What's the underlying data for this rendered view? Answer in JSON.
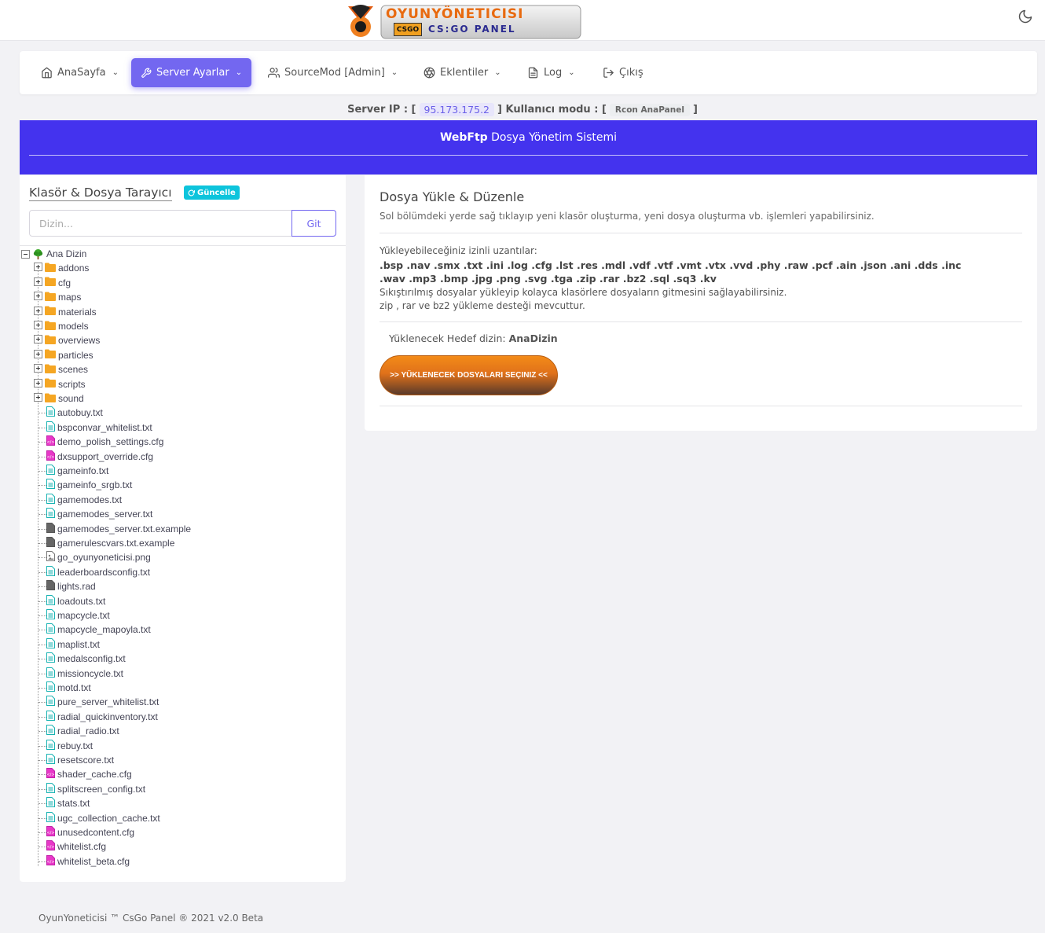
{
  "colors": {
    "accent": "#7367f0",
    "banner": "#4433ee",
    "refresh": "#0dc4dc",
    "upload_orange": "#f38b18"
  },
  "header": {
    "logo_text_top": "OYUNYÖNETICISI",
    "logo_text_badge": "CSGO",
    "logo_text_bottom": "CS:GO PANEL",
    "theme_icon": "moon-icon"
  },
  "nav": {
    "items": [
      {
        "label": "AnaSayfa",
        "icon": "home-icon"
      },
      {
        "label": "Server Ayarlar",
        "icon": "wrench-icon"
      },
      {
        "label": "SourceMod [Admin]",
        "icon": "users-icon"
      },
      {
        "label": "Eklentiler",
        "icon": "aperture-icon"
      },
      {
        "label": "Log",
        "icon": "file-text-icon"
      },
      {
        "label": "Çıkış",
        "icon": "logout-icon"
      }
    ]
  },
  "server": {
    "ip_label": "Server IP : [",
    "ip": "95.173.175.2",
    "mode_label": "] Kullanıcı modu : [",
    "mode": "Rcon AnaPanel",
    "close": "]"
  },
  "banner": {
    "title_bold": "WebFtp",
    "title_rest": " Dosya Yönetim Sistemi"
  },
  "browser": {
    "title": "Klasör & Dosya Tarayıcı",
    "refresh_label": "Güncelle",
    "dir_placeholder": "Dizin...",
    "go_label": "Git",
    "root": "Ana Dizin",
    "folders": [
      "addons",
      "cfg",
      "maps",
      "materials",
      "models",
      "overviews",
      "particles",
      "scenes",
      "scripts",
      "sound"
    ],
    "files": [
      {
        "name": "autobuy.txt",
        "type": "txt"
      },
      {
        "name": "bspconvar_whitelist.txt",
        "type": "txt"
      },
      {
        "name": "demo_polish_settings.cfg",
        "type": "cfg"
      },
      {
        "name": "dxsupport_override.cfg",
        "type": "cfg"
      },
      {
        "name": "gameinfo.txt",
        "type": "txt"
      },
      {
        "name": "gameinfo_srgb.txt",
        "type": "txt"
      },
      {
        "name": "gamemodes.txt",
        "type": "txt"
      },
      {
        "name": "gamemodes_server.txt",
        "type": "txt"
      },
      {
        "name": "gamemodes_server.txt.example",
        "type": "gen"
      },
      {
        "name": "gamerulescvars.txt.example",
        "type": "gen"
      },
      {
        "name": "go_oyunyoneticisi.png",
        "type": "img"
      },
      {
        "name": "leaderboardsconfig.txt",
        "type": "txt"
      },
      {
        "name": "lights.rad",
        "type": "gen"
      },
      {
        "name": "loadouts.txt",
        "type": "txt"
      },
      {
        "name": "mapcycle.txt",
        "type": "txt"
      },
      {
        "name": "mapcycle_mapoyla.txt",
        "type": "txt"
      },
      {
        "name": "maplist.txt",
        "type": "txt"
      },
      {
        "name": "medalsconfig.txt",
        "type": "txt"
      },
      {
        "name": "missioncycle.txt",
        "type": "txt"
      },
      {
        "name": "motd.txt",
        "type": "txt"
      },
      {
        "name": "pure_server_whitelist.txt",
        "type": "txt"
      },
      {
        "name": "radial_quickinventory.txt",
        "type": "txt"
      },
      {
        "name": "radial_radio.txt",
        "type": "txt"
      },
      {
        "name": "rebuy.txt",
        "type": "txt"
      },
      {
        "name": "resetscore.txt",
        "type": "txt"
      },
      {
        "name": "shader_cache.cfg",
        "type": "cfg"
      },
      {
        "name": "splitscreen_config.txt",
        "type": "txt"
      },
      {
        "name": "stats.txt",
        "type": "txt"
      },
      {
        "name": "ugc_collection_cache.txt",
        "type": "txt"
      },
      {
        "name": "unusedcontent.cfg",
        "type": "cfg"
      },
      {
        "name": "whitelist.cfg",
        "type": "cfg"
      },
      {
        "name": "whitelist_beta.cfg",
        "type": "cfg"
      }
    ]
  },
  "upload": {
    "title": "Dosya Yükle & Düzenle",
    "description": "Sol bölümdeki yerde sağ tıklayıp yeni klasör oluşturma, yeni dosya oluşturma vb. işlemleri yapabilirsiniz.",
    "ext_label": "Yükleyebileceğiniz izinli uzantılar:",
    "ext_line1": ".bsp .nav .smx .txt .ini .log .cfg .lst .res .mdl .vdf .vtf .vmt .vtx .vvd .phy .raw .pcf .ain .json .ani .dds .inc",
    "ext_line2": ".wav .mp3 .bmp .jpg .png .svg .tga .zip .rar .bz2 .sql .sq3 .kv",
    "compress_note": "Sıkıştırılmış dosyalar yükleyip kolayca klasörlere dosyaların gitmesini sağlayabilirsiniz.",
    "formats_note": "zip , rar ve bz2 yükleme desteği mevcuttur.",
    "target_label": "Yüklenecek Hedef dizin: ",
    "target_value": "AnaDizin",
    "button_label": ">> YÜKLENECEK DOSYALARI SEÇINIZ <<"
  },
  "footer": {
    "text": "OyunYoneticisi ™ CsGo Panel ® 2021 v2.0 Beta"
  }
}
